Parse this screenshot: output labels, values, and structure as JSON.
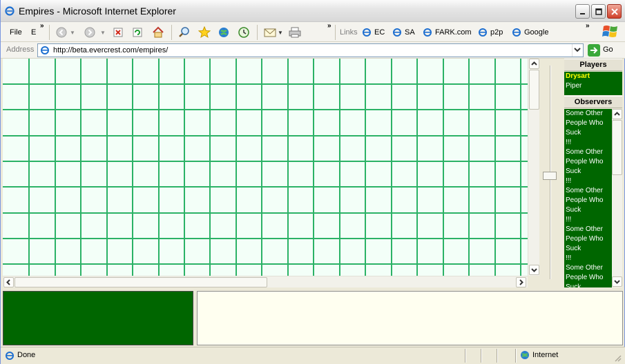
{
  "window": {
    "title": "Empires - Microsoft Internet Explorer"
  },
  "toolbar": {
    "menu_file": "File",
    "menu_edit": "E",
    "links_label": "Links",
    "links": [
      "EC",
      "SA",
      "FARK.com",
      "p2p",
      "Google"
    ],
    "icons": [
      "back-icon",
      "forward-icon",
      "stop-icon",
      "refresh-icon",
      "home-icon",
      "search-icon",
      "favorites-icon",
      "media-icon",
      "history-icon",
      "mail-icon",
      "print-icon"
    ]
  },
  "address": {
    "label": "Address",
    "url": "http://beta.evercrest.com/empires/",
    "go_label": "Go"
  },
  "game": {
    "grid_line_color": "#2bb266",
    "grid_bg_color": "#f3fff8",
    "panel_color": "#006600",
    "active_player_color": "#ffff00"
  },
  "players": {
    "header": "Players",
    "items": [
      "Drysart",
      "Piper"
    ]
  },
  "observers": {
    "header": "Observers",
    "items": [
      "Some Other People Who Suck",
      "!!!",
      "Some Other People Who Suck",
      "!!!",
      "Some Other People Who Suck",
      "!!!",
      "Some Other People Who Suck",
      "!!!",
      "Some Other People Who Suck"
    ]
  },
  "status": {
    "text": "Done",
    "zone": "Internet"
  }
}
